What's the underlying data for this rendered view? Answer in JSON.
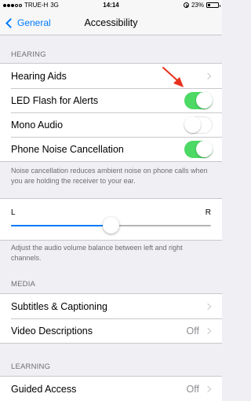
{
  "status_bar": {
    "carrier": "TRUE-H",
    "network": "3G",
    "time": "14:14",
    "battery": "23%",
    "battery_level": 0.23
  },
  "nav": {
    "back_label": "General",
    "title": "Accessibility"
  },
  "hearing": {
    "header": "HEARING",
    "items": [
      {
        "label": "Hearing Aids",
        "accessory": "chevron"
      },
      {
        "label": "LED Flash for Alerts",
        "accessory": "toggle",
        "on": true
      },
      {
        "label": "Mono Audio",
        "accessory": "toggle",
        "on": false
      },
      {
        "label": "Phone Noise Cancellation",
        "accessory": "toggle",
        "on": true
      }
    ],
    "footer": "Noise cancellation reduces ambient noise on phone calls when you are holding the receiver to your ear."
  },
  "balance": {
    "left_label": "L",
    "right_label": "R",
    "value": 0.5,
    "footer": "Adjust the audio volume balance between left and right channels."
  },
  "media": {
    "header": "MEDIA",
    "items": [
      {
        "label": "Subtitles & Captioning",
        "accessory": "chevron"
      },
      {
        "label": "Video Descriptions",
        "value": "Off",
        "accessory": "chevron"
      }
    ]
  },
  "learning": {
    "header": "LEARNING",
    "items": [
      {
        "label": "Guided Access",
        "value": "Off",
        "accessory": "chevron"
      }
    ]
  },
  "colors": {
    "accent": "#007aff",
    "toggle_on": "#4cd964",
    "arrow": "#e8301c"
  }
}
